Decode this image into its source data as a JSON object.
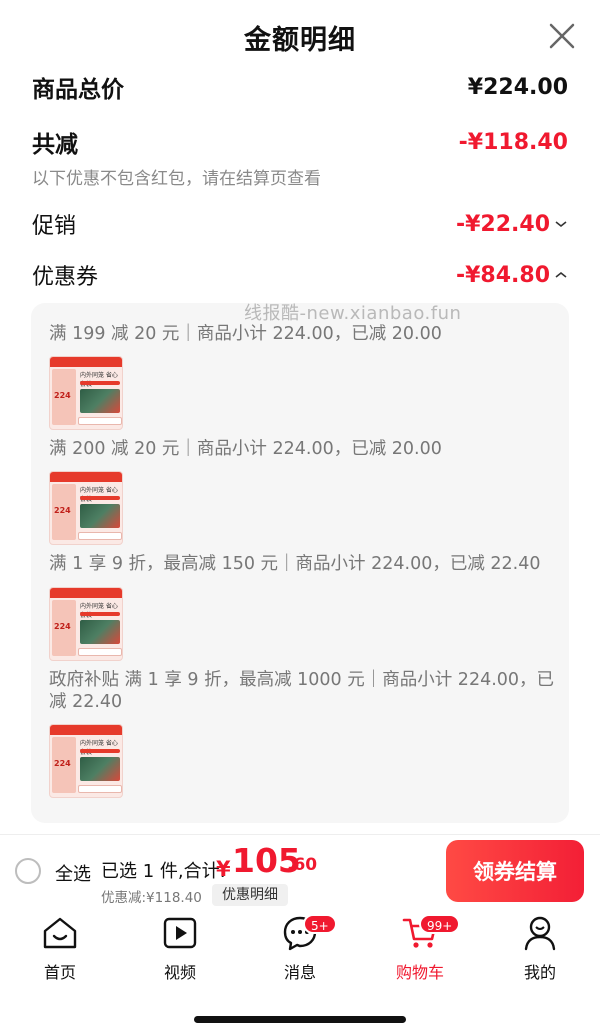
{
  "header": {
    "title": "金额明细"
  },
  "summary": {
    "goods_total_label": "商品总价",
    "goods_total_value": "¥224.00",
    "total_reduction_label": "共减",
    "total_reduction_value": "-¥118.40",
    "note": "以下优惠不包含红包，请在结算页查看",
    "promo_label": "促销",
    "promo_value": "-¥22.40",
    "coupon_label": "优惠券",
    "coupon_value": "-¥84.80"
  },
  "watermark": "线报酷-new.xianbao.fun",
  "coupons": [
    {
      "text": "满 199 减 20 元｜商品小计 224.00，已减 20.00"
    },
    {
      "text": "满 200 减 20 元｜商品小计 224.00，已减 20.00"
    },
    {
      "text": "满 1 享 9 折，最高减 150 元｜商品小计 224.00，已减 22.40"
    },
    {
      "text": "政府补贴 满 1 享 9 折，最高减 1000 元｜商品小计 224.00，已减 22.40"
    }
  ],
  "thumb": {
    "title": "内外同笼 省心套装",
    "price": "224"
  },
  "checkout": {
    "select_all": "全选",
    "selected_count": "已选 1 件,合计:",
    "total_currency": "¥",
    "total_integer": "105",
    "total_decimal": ".60",
    "discount_text": "优惠减:¥118.40",
    "detail_label": "优惠明细",
    "button_label": "领券结算"
  },
  "tabbar": {
    "items": [
      {
        "label": "首页"
      },
      {
        "label": "视频"
      },
      {
        "label": "消息",
        "badge": "5+"
      },
      {
        "label": "购物车",
        "badge": "99+"
      },
      {
        "label": "我的"
      }
    ]
  },
  "colors": {
    "accent": "#f0192f",
    "muted": "#8a8a8a",
    "panel": "#f6f6f6"
  }
}
